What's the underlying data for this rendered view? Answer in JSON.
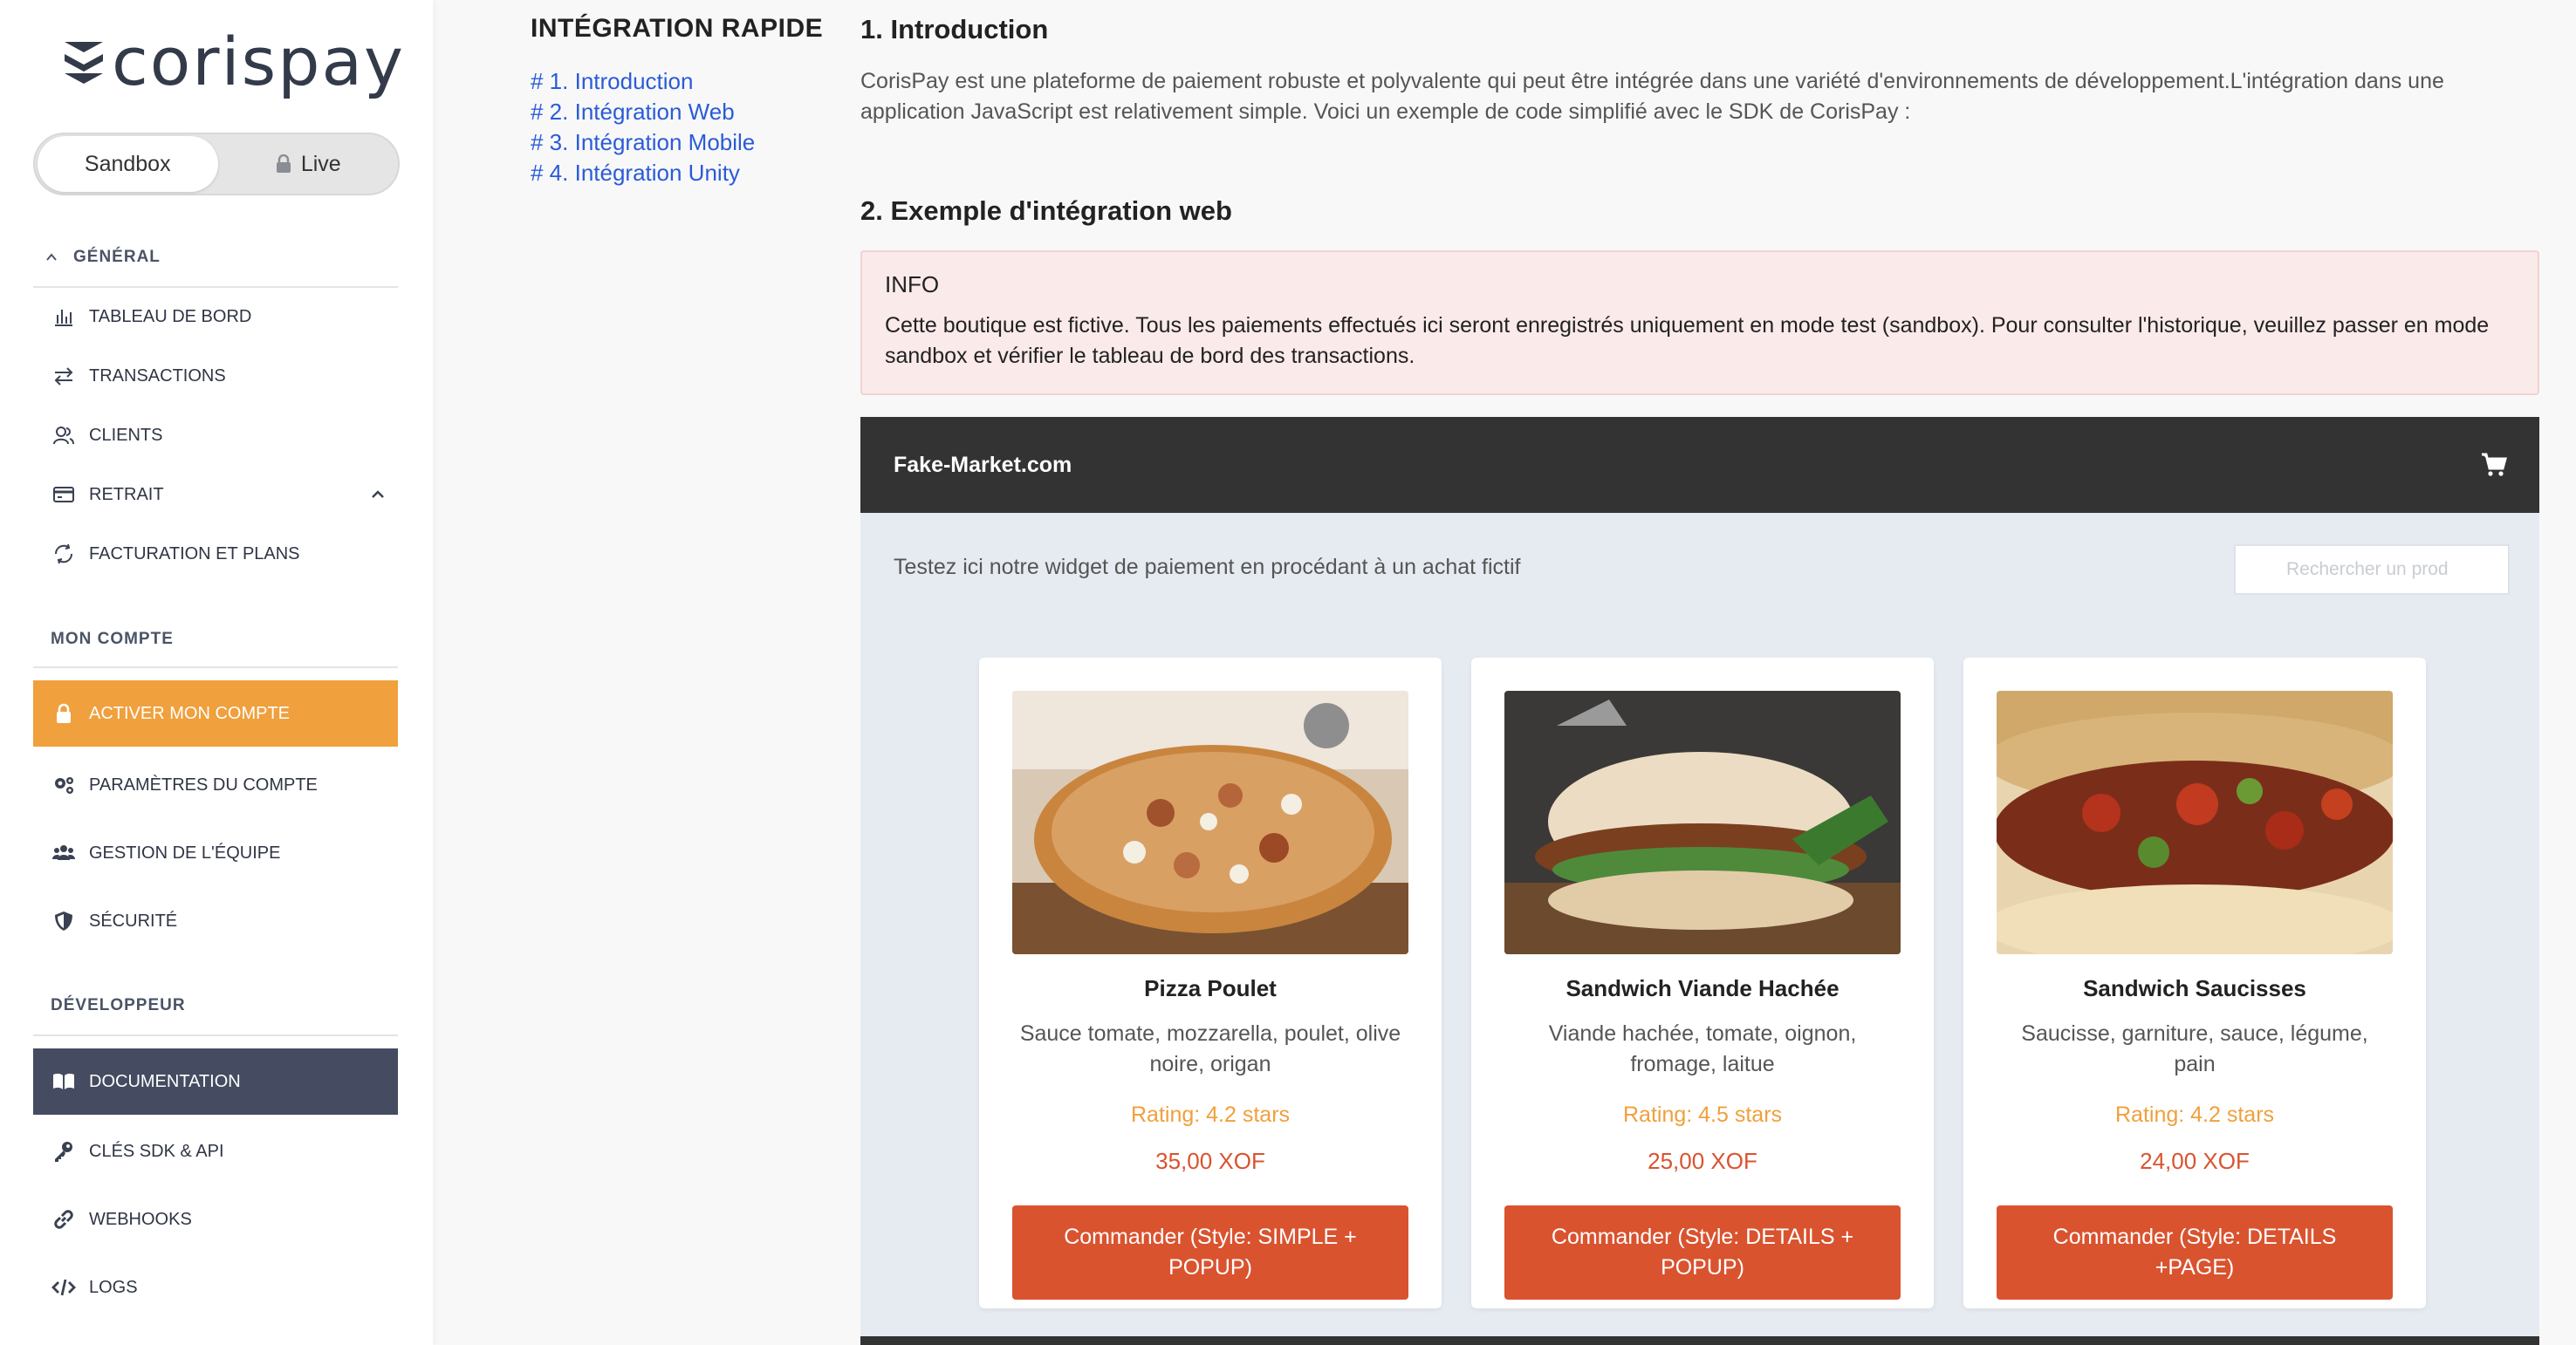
{
  "brand": {
    "logo_text": "corispay"
  },
  "env_toggle": {
    "sandbox": "Sandbox",
    "live": "Live",
    "active": "sandbox"
  },
  "sidebar": {
    "general_label": "GÉNÉRAL",
    "general_items": [
      {
        "label": "TABLEAU DE BORD",
        "icon": "bar-chart-icon"
      },
      {
        "label": "TRANSACTIONS",
        "icon": "arrows-exchange-icon"
      },
      {
        "label": "CLIENTS",
        "icon": "users-icon"
      },
      {
        "label": "RETRAIT",
        "icon": "credit-card-icon"
      },
      {
        "label": "FACTURATION ET PLANS",
        "icon": "refresh-icon"
      }
    ],
    "account_label": "MON COMPTE",
    "account_items": [
      {
        "label": "ACTIVER MON COMPTE",
        "icon": "lock-icon"
      },
      {
        "label": "PARAMÈTRES DU COMPTE",
        "icon": "gears-icon"
      },
      {
        "label": "GESTION DE L'ÉQUIPE",
        "icon": "team-icon"
      },
      {
        "label": "SÉCURITÉ",
        "icon": "shield-icon"
      }
    ],
    "dev_label": "DÉVELOPPEUR",
    "dev_items": [
      {
        "label": "DOCUMENTATION",
        "icon": "book-icon"
      },
      {
        "label": "CLÉS SDK & API",
        "icon": "key-icon"
      },
      {
        "label": "WEBHOOKS",
        "icon": "link-icon"
      },
      {
        "label": "LOGS",
        "icon": "code-icon"
      }
    ]
  },
  "toc": {
    "title": "INTÉGRATION RAPIDE",
    "links": [
      "# 1. Introduction",
      "# 2. Intégration Web",
      "# 3. Intégration Mobile",
      "# 4. Intégration Unity"
    ]
  },
  "main": {
    "intro_heading": "1. Introduction",
    "intro_text": "CorisPay est une plateforme de paiement robuste et polyvalente qui peut être intégrée dans une variété d'environnements de développement.L'intégration dans une application JavaScript est relativement simple. Voici un exemple de code simplifié avec le SDK de CorisPay :",
    "web_heading": "2. Exemple d'intégration web",
    "info_title": "INFO",
    "info_text": "Cette boutique est fictive. Tous les paiements effectués ici seront enregistrés uniquement en mode test (sandbox). Pour consulter l'historique, veuillez passer en mode sandbox et vérifier le tableau de bord des transactions."
  },
  "market": {
    "name": "Fake-Market.com",
    "note": "Testez ici notre widget de paiement en procédant à un achat fictif",
    "search_placeholder": "Rechercher un prod",
    "products": [
      {
        "title": "Pizza Poulet",
        "desc": "Sauce tomate, mozzarella, poulet, olive noire, origan",
        "rating": "Rating: 4.2 stars",
        "price": "35,00 XOF",
        "button": "Commander (Style: SIMPLE + POPUP)"
      },
      {
        "title": "Sandwich Viande Hachée",
        "desc": "Viande hachée, tomate, oignon, fromage, laitue",
        "rating": "Rating: 4.5 stars",
        "price": "25,00 XOF",
        "button": "Commander (Style: DETAILS + POPUP)"
      },
      {
        "title": "Sandwich Saucisses",
        "desc": "Saucisse, garniture, sauce, légume, pain",
        "rating": "Rating: 4.2 stars",
        "price": "24,00 XOF",
        "button": "Commander (Style: DETAILS +PAGE)"
      }
    ]
  },
  "colors": {
    "accent_orange": "#f0a03c",
    "button_red": "#d9532f",
    "nav_dark": "#454c61",
    "link_blue": "#2a5bd7"
  }
}
